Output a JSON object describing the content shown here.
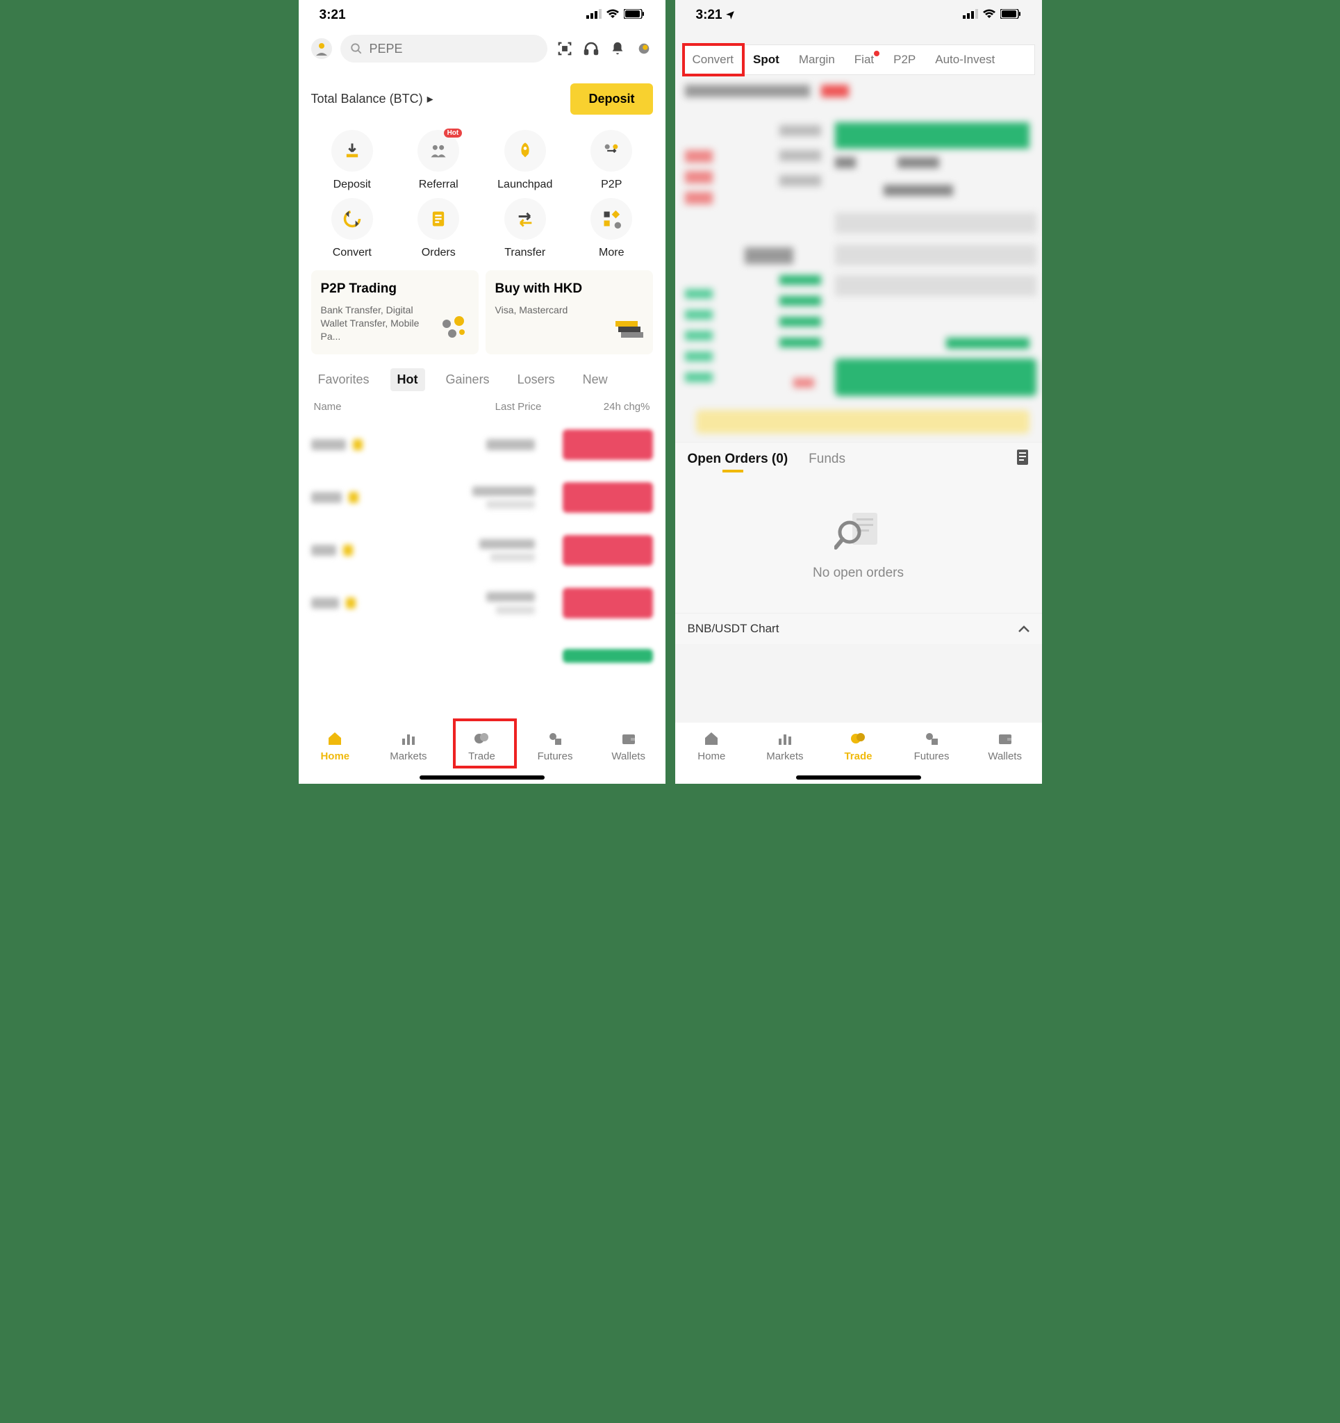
{
  "status": {
    "time": "3:21"
  },
  "left": {
    "search_placeholder": "PEPE",
    "balance_label": "Total Balance (BTC)",
    "deposit_button": "Deposit",
    "quick": [
      {
        "label": "Deposit",
        "icon": "download"
      },
      {
        "label": "Referral",
        "icon": "referral",
        "badge": "Hot"
      },
      {
        "label": "Launchpad",
        "icon": "rocket"
      },
      {
        "label": "P2P",
        "icon": "p2p"
      },
      {
        "label": "Convert",
        "icon": "convert"
      },
      {
        "label": "Orders",
        "icon": "orders"
      },
      {
        "label": "Transfer",
        "icon": "transfer"
      },
      {
        "label": "More",
        "icon": "more"
      }
    ],
    "promo": [
      {
        "title": "P2P Trading",
        "sub": "Bank Transfer, Digital Wallet Transfer, Mobile Pa..."
      },
      {
        "title": "Buy with HKD",
        "sub": "Visa, Mastercard"
      }
    ],
    "market_tabs": [
      "Favorites",
      "Hot",
      "Gainers",
      "Losers",
      "New"
    ],
    "market_tab_active": "Hot",
    "table_headers": {
      "name": "Name",
      "price": "Last Price",
      "chg": "24h chg%"
    }
  },
  "right": {
    "trade_tabs": [
      "Convert",
      "Spot",
      "Margin",
      "Fiat",
      "P2P",
      "Auto-Invest"
    ],
    "trade_tab_highlighted": "Convert",
    "trade_tab_active": "Spot",
    "fiat_dot": true,
    "orders_tabs": {
      "open": "Open Orders (0)",
      "funds": "Funds"
    },
    "empty_text": "No open orders",
    "chart_label": "BNB/USDT Chart"
  },
  "nav": [
    {
      "label": "Home",
      "icon": "home"
    },
    {
      "label": "Markets",
      "icon": "markets"
    },
    {
      "label": "Trade",
      "icon": "trade"
    },
    {
      "label": "Futures",
      "icon": "futures"
    },
    {
      "label": "Wallets",
      "icon": "wallets"
    }
  ],
  "nav_active_left": "Home",
  "nav_active_right": "Trade"
}
